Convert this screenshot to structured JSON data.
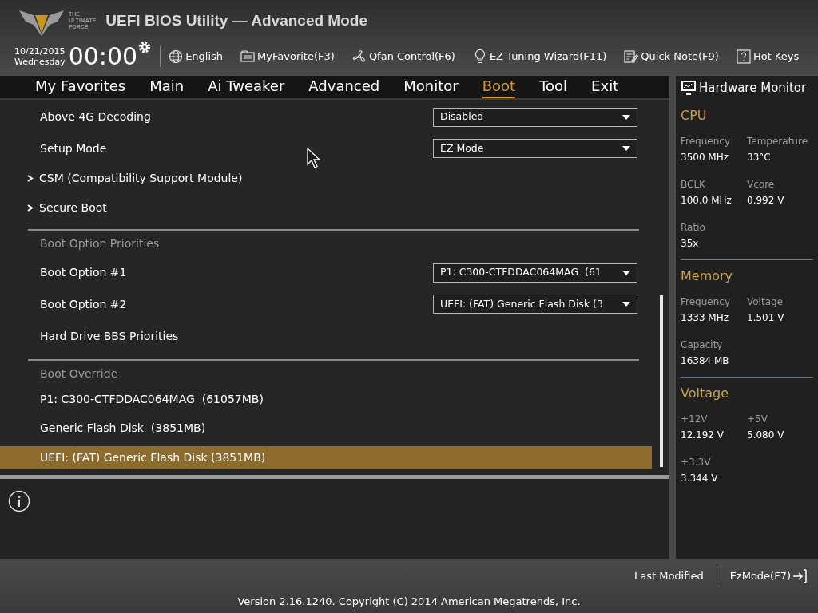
{
  "header": {
    "logo_text": [
      "THE",
      "ULTIMATE",
      "FORCE"
    ],
    "title": "UEFI BIOS Utility — Advanced Mode",
    "date": "10/21/2015",
    "day": "Wednesday",
    "time": "00:00"
  },
  "toolbar": [
    {
      "kind": "globe",
      "label": "English"
    },
    {
      "kind": "favorite",
      "label": "MyFavorite(F3)"
    },
    {
      "kind": "fan",
      "label": "Qfan Control(F6)"
    },
    {
      "kind": "bulb",
      "label": "EZ Tuning Wizard(F11)"
    },
    {
      "kind": "note",
      "label": "Quick Note(F9)"
    },
    {
      "kind": "help",
      "label": "Hot Keys"
    }
  ],
  "tabs": [
    {
      "label": "My Favorites",
      "selected": false
    },
    {
      "label": "Main",
      "selected": false
    },
    {
      "label": "Ai Tweaker",
      "selected": false
    },
    {
      "label": "Advanced",
      "selected": false
    },
    {
      "label": "Monitor",
      "selected": false
    },
    {
      "label": "Boot",
      "selected": true
    },
    {
      "label": "Tool",
      "selected": false
    },
    {
      "label": "Exit",
      "selected": false
    }
  ],
  "rows": [
    {
      "kind": "dropdown",
      "label": "Above 4G Decoding",
      "value": "Disabled"
    },
    {
      "kind": "dropdown",
      "label": "Setup Mode",
      "value": "EZ Mode"
    },
    {
      "kind": "submenu",
      "label": "CSM (Compatibility Support Module)"
    },
    {
      "kind": "submenu",
      "label": "Secure Boot"
    },
    {
      "kind": "section",
      "label": "Boot Option Priorities"
    },
    {
      "kind": "dropdown",
      "label": "Boot Option #1",
      "value": "P1: C300-CTFDDAC064MAG  (61"
    },
    {
      "kind": "dropdown",
      "label": "Boot Option #2",
      "value": "UEFI: (FAT) Generic Flash Disk (3"
    },
    {
      "kind": "link",
      "label": "Hard Drive BBS Priorities"
    },
    {
      "kind": "section",
      "label": "Boot Override"
    },
    {
      "kind": "option",
      "label": "P1: C300-CTFDDAC064MAG  (61057MB)",
      "selected": false
    },
    {
      "kind": "option",
      "label": "Generic Flash Disk  (3851MB)",
      "selected": false
    },
    {
      "kind": "option",
      "label": "UEFI: (FAT) Generic Flash Disk (3851MB)",
      "selected": true
    }
  ],
  "hardware_monitor": {
    "title": "Hardware Monitor",
    "groups": [
      {
        "title": "CPU",
        "items": [
          {
            "label": "Frequency",
            "value": "3500 MHz"
          },
          {
            "label": "Temperature",
            "value": "33°C"
          },
          {
            "label": "BCLK",
            "value": "100.0 MHz"
          },
          {
            "label": "Vcore",
            "value": "0.992 V"
          },
          {
            "label": "Ratio",
            "value": "35x"
          }
        ]
      },
      {
        "title": "Memory",
        "items": [
          {
            "label": "Frequency",
            "value": "1333 MHz"
          },
          {
            "label": "Voltage",
            "value": "1.501 V"
          },
          {
            "label": "Capacity",
            "value": "16384 MB"
          }
        ]
      },
      {
        "title": "Voltage",
        "items": [
          {
            "label": "+12V",
            "value": "12.192 V"
          },
          {
            "label": "+5V",
            "value": "5.080 V"
          },
          {
            "label": "+3.3V",
            "value": "3.344 V"
          }
        ]
      }
    ]
  },
  "footer": {
    "last_modified": "Last Modified",
    "ez_mode": "EzMode(F7)",
    "copyright": "Version 2.16.1240. Copyright (C) 2014 American Megatrends, Inc."
  }
}
